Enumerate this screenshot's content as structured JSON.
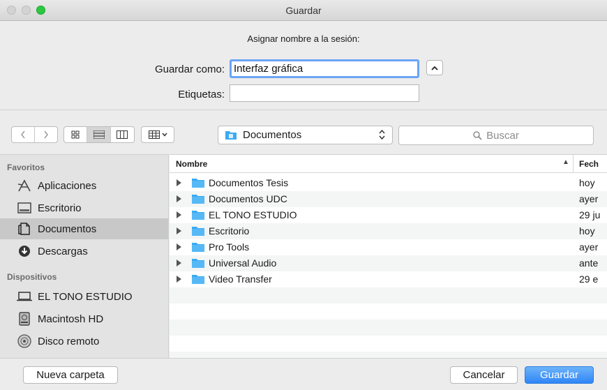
{
  "window": {
    "title": "Guardar"
  },
  "form": {
    "prompt": "Asignar nombre a la sesión:",
    "save_as_label": "Guardar como:",
    "save_as_value": "Interfaz gráfica",
    "tags_label": "Etiquetas:",
    "tags_value": ""
  },
  "toolbar": {
    "location": "Documentos",
    "search_placeholder": "Buscar",
    "active_view": "list"
  },
  "sidebar": {
    "favorites_title": "Favoritos",
    "favorites": [
      {
        "label": "Aplicaciones",
        "icon": "applications-icon"
      },
      {
        "label": "Escritorio",
        "icon": "desktop-icon"
      },
      {
        "label": "Documentos",
        "icon": "documents-icon",
        "selected": true
      },
      {
        "label": "Descargas",
        "icon": "downloads-icon"
      }
    ],
    "devices_title": "Dispositivos",
    "devices": [
      {
        "label": "EL TONO ESTUDIO",
        "icon": "computer-icon"
      },
      {
        "label": "Macintosh HD",
        "icon": "hard-drive-icon"
      },
      {
        "label": "Disco remoto",
        "icon": "remote-disc-icon"
      }
    ]
  },
  "list": {
    "col_name": "Nombre",
    "col_date": "Fech",
    "rows": [
      {
        "name": "Documentos Tesis",
        "date": "hoy"
      },
      {
        "name": "Documentos UDC",
        "date": "ayer"
      },
      {
        "name": "EL TONO ESTUDIO",
        "date": "29 ju"
      },
      {
        "name": "Escritorio",
        "date": "hoy"
      },
      {
        "name": "Pro Tools",
        "date": "ayer"
      },
      {
        "name": "Universal Audio",
        "date": "ante"
      },
      {
        "name": "Video Transfer",
        "date": "29 e"
      }
    ]
  },
  "buttons": {
    "new_folder": "Nueva carpeta",
    "cancel": "Cancelar",
    "save": "Guardar"
  },
  "colors": {
    "accent": "#2f86f6",
    "folder": "#3aaaf0"
  }
}
